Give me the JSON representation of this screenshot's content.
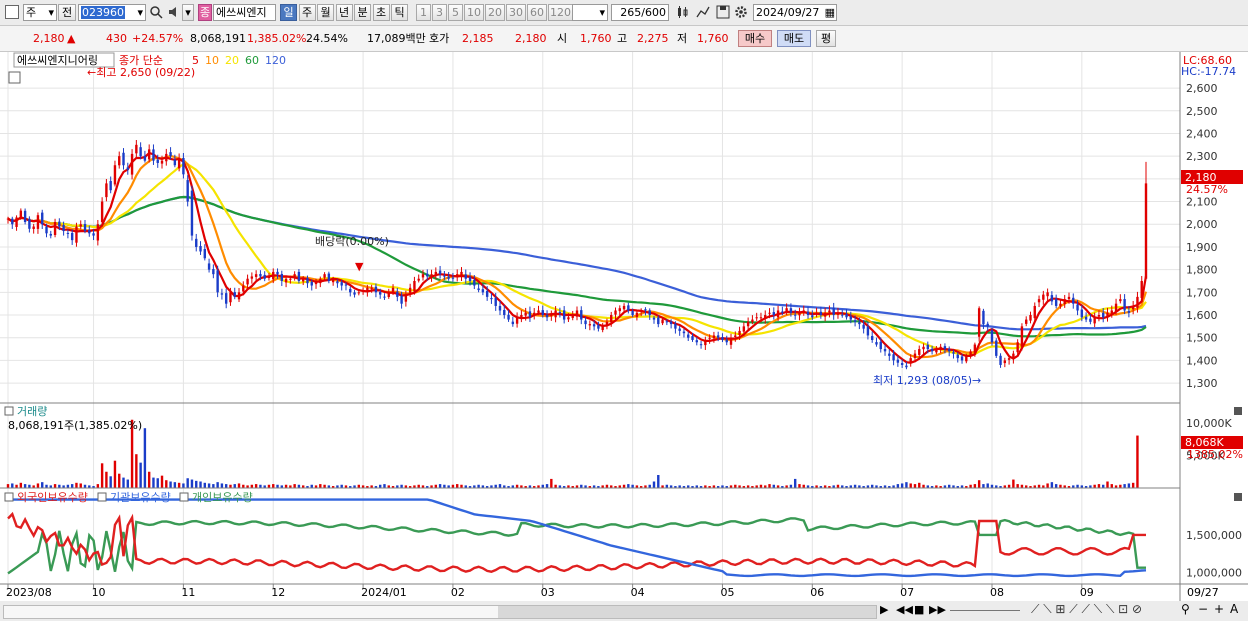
{
  "toolbar": {
    "market": "주",
    "prev": "전",
    "code": "023960",
    "badge": "종",
    "name": "에쓰씨엔지",
    "periods": [
      "일",
      "주",
      "월",
      "년",
      "분",
      "초",
      "틱"
    ],
    "active_period": "일",
    "minutes": [
      "1",
      "3",
      "5",
      "10",
      "20",
      "30",
      "60",
      "120"
    ],
    "count": "265",
    "count_total": "/600",
    "date": "2024/09/27"
  },
  "quote": {
    "price": "2,180",
    "change_arrow": "▲",
    "change": "430",
    "change_pct": "+24.57%",
    "volume": "8,068,191",
    "volume_pct": "1,385.02%",
    "turnover": "24.54%",
    "value": "17,089백만",
    "ask_label": "호가",
    "ask": "2,185",
    "bid": "2,180",
    "open_label": "시",
    "open": "1,760",
    "high_label": "고",
    "high": "2,275",
    "low_label": "저",
    "low": "1,760",
    "buy": "매수",
    "sell": "매도",
    "eval": "평"
  },
  "colors": {
    "up": "#e00000",
    "down": "#1a3cc8",
    "ma5": "#e00000",
    "ma10": "#ff8c00",
    "ma20": "#f5e400",
    "ma60": "#1f9a3a",
    "ma120": "#3b5fd8",
    "foreign": "#e02020",
    "institution": "#3366dd",
    "individual": "#3a9a55"
  },
  "chart_data": [
    {
      "type": "candlestick",
      "title": "에쓰씨엔지니어링",
      "legend": [
        "종가 단순",
        "5",
        "10",
        "20",
        "60",
        "120"
      ],
      "lc_label": "LC:68.60",
      "hc_label": "HC:-17.74",
      "yticks": [
        "2,600",
        "2,500",
        "2,400",
        "2,300",
        "2,200",
        "2,100",
        "2,000",
        "1,900",
        "1,800",
        "1,700",
        "1,600",
        "1,500",
        "1,400",
        "1,300"
      ],
      "ylim": [
        1230,
        2640
      ],
      "last_price": "2,180",
      "last_pct": "24.57%",
      "annotations": {
        "high": "최고 2,650 (09/22)",
        "dividend": "배당락(0.00%)",
        "low": "최저 1,293 (08/05)"
      },
      "x_labels": [
        "2023/08",
        "10",
        "11",
        "12",
        "2024/01",
        "02",
        "03",
        "04",
        "05",
        "06",
        "07",
        "08",
        "09",
        "09/27"
      ],
      "close": [
        2025,
        2000,
        2030,
        2060,
        2010,
        1980,
        1990,
        2040,
        2000,
        1960,
        1950,
        2010,
        1990,
        1970,
        1960,
        1930,
        1990,
        2000,
        1970,
        1960,
        1950,
        2000,
        2100,
        2180,
        2150,
        2260,
        2300,
        2260,
        2240,
        2310,
        2350,
        2300,
        2280,
        2330,
        2280,
        2270,
        2280,
        2310,
        2300,
        2260,
        2290,
        2220,
        2100,
        1950,
        1900,
        1880,
        1850,
        1800,
        1780,
        1700,
        1690,
        1650,
        1700,
        1680,
        1700,
        1730,
        1760,
        1770,
        1780,
        1770,
        1760,
        1770,
        1790,
        1780,
        1750,
        1760,
        1760,
        1780,
        1750,
        1760,
        1740,
        1730,
        1750,
        1760,
        1780,
        1750,
        1760,
        1740,
        1730,
        1730,
        1700,
        1690,
        1700,
        1710,
        1720,
        1720,
        1700,
        1690,
        1680,
        1700,
        1720,
        1680,
        1650,
        1690,
        1720,
        1750,
        1760,
        1780,
        1770,
        1780,
        1790,
        1780,
        1770,
        1760,
        1760,
        1780,
        1790,
        1760,
        1750,
        1730,
        1710,
        1700,
        1680,
        1670,
        1640,
        1620,
        1600,
        1580,
        1560,
        1590,
        1600,
        1610,
        1590,
        1610,
        1620,
        1600,
        1590,
        1600,
        1620,
        1610,
        1580,
        1590,
        1600,
        1620,
        1580,
        1560,
        1560,
        1550,
        1540,
        1550,
        1570,
        1600,
        1620,
        1630,
        1640,
        1620,
        1600,
        1610,
        1620,
        1620,
        1600,
        1580,
        1560,
        1580,
        1570,
        1560,
        1540,
        1530,
        1520,
        1500,
        1490,
        1480,
        1470,
        1490,
        1500,
        1510,
        1500,
        1490,
        1480,
        1500,
        1510,
        1530,
        1550,
        1570,
        1580,
        1590,
        1590,
        1600,
        1610,
        1600,
        1620,
        1610,
        1630,
        1610,
        1600,
        1610,
        1620,
        1600,
        1590,
        1610,
        1600,
        1610,
        1620,
        1600,
        1610,
        1600,
        1590,
        1580,
        1570,
        1560,
        1540,
        1510,
        1490,
        1470,
        1450,
        1440,
        1420,
        1400,
        1390,
        1380,
        1370,
        1410,
        1430,
        1450,
        1460,
        1450,
        1440,
        1450,
        1460,
        1450,
        1440,
        1430,
        1410,
        1400,
        1420,
        1440,
        1470,
        1630,
        1560,
        1550,
        1480,
        1420,
        1380,
        1400,
        1410,
        1430,
        1480,
        1550,
        1580,
        1600,
        1640,
        1670,
        1690,
        1700,
        1660,
        1640,
        1650,
        1670,
        1680,
        1650,
        1620,
        1590,
        1580,
        1570,
        1590,
        1600,
        1590,
        1610,
        1620,
        1650,
        1670,
        1620,
        1610,
        1640,
        1680,
        1750,
        2180
      ],
      "volume_label": "거래량",
      "volume_value": "8,068,191주(1,385.02%)",
      "volume_yticks": [
        "10,000K",
        "5,000K"
      ],
      "volume_last": "8,068K",
      "volume_last_pct": "1385.02%",
      "volume_ylim": [
        0,
        12000
      ],
      "volume": [
        600,
        700,
        500,
        800,
        600,
        500,
        400,
        700,
        900,
        500,
        400,
        600,
        500,
        400,
        500,
        600,
        800,
        700,
        500,
        400,
        300,
        600,
        3800,
        2500,
        1800,
        4200,
        2200,
        1600,
        1300,
        10500,
        5200,
        3900,
        9200,
        2500,
        1600,
        1500,
        1900,
        1200,
        1000,
        900,
        800,
        700,
        1500,
        1300,
        1100,
        1000,
        800,
        700,
        600,
        900,
        700,
        600,
        500,
        600,
        700,
        500,
        400,
        500,
        600,
        500,
        400,
        500,
        600,
        500,
        400,
        500,
        400,
        600,
        500,
        400,
        300,
        500,
        400,
        600,
        500,
        400,
        300,
        400,
        500,
        400,
        300,
        400,
        500,
        400,
        300,
        400,
        300,
        500,
        600,
        400,
        300,
        400,
        500,
        400,
        300,
        400,
        500,
        400,
        300,
        400,
        500,
        600,
        500,
        400,
        500,
        600,
        500,
        400,
        300,
        400,
        500,
        400,
        300,
        400,
        500,
        600,
        400,
        300,
        400,
        500,
        400,
        300,
        400,
        300,
        400,
        500,
        600,
        1400,
        500,
        400,
        300,
        400,
        300,
        400,
        500,
        400,
        300,
        400,
        300,
        400,
        500,
        400,
        300,
        400,
        500,
        600,
        500,
        400,
        300,
        400,
        500,
        1000,
        2000,
        400,
        500,
        400,
        300,
        400,
        300,
        400,
        300,
        400,
        300,
        400,
        300,
        400,
        300,
        400,
        300,
        400,
        500,
        400,
        300,
        400,
        300,
        400,
        500,
        400,
        600,
        500,
        400,
        300,
        400,
        500,
        1400,
        600,
        500,
        400,
        300,
        400,
        300,
        400,
        300,
        400,
        500,
        400,
        300,
        400,
        500,
        400,
        300,
        400,
        500,
        400,
        300,
        400,
        300,
        400,
        600,
        700,
        900,
        700,
        600,
        800,
        500,
        400,
        300,
        400,
        300,
        400,
        500,
        400,
        300,
        400,
        300,
        500,
        600,
        1200,
        600,
        700,
        500,
        400,
        300,
        400,
        500,
        1300,
        600,
        500,
        400,
        300,
        400,
        500,
        400,
        700,
        900,
        600,
        500,
        400,
        300,
        400,
        500,
        400,
        300,
        400,
        500,
        600,
        500,
        1000,
        600,
        400,
        500,
        600,
        700,
        800,
        8068
      ],
      "holding_legend": [
        "외국인보유수량",
        "기관보유수량",
        "개인보유수량"
      ],
      "holding_yticks": [
        "1,500,000",
        "1,000,000"
      ]
    }
  ]
}
